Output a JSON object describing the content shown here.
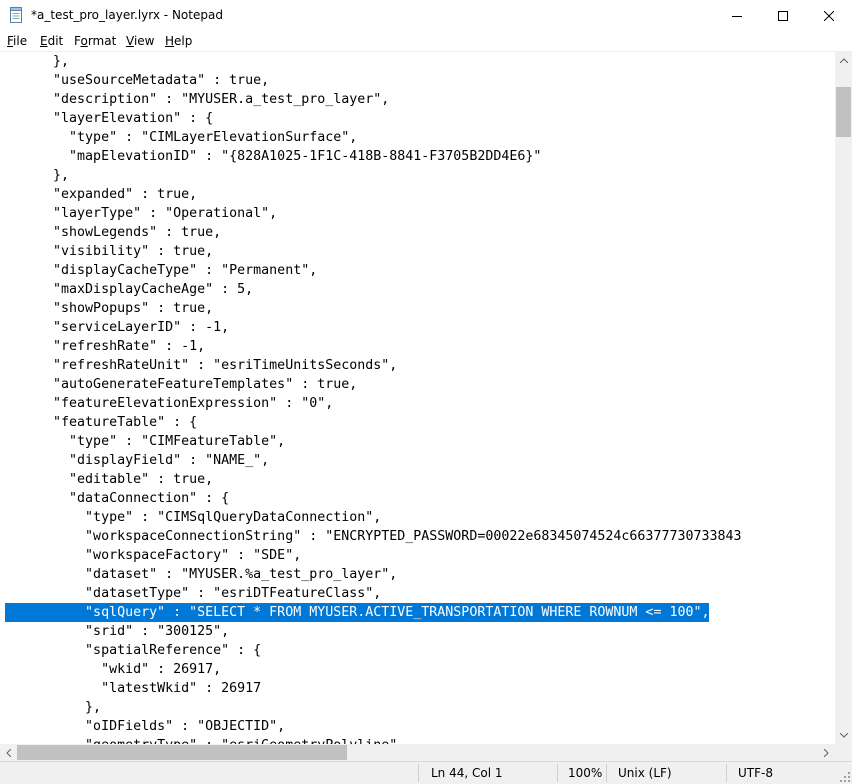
{
  "window": {
    "title": "*a_test_pro_layer.lyrx - Notepad"
  },
  "menu": {
    "items": [
      {
        "underline": "F",
        "rest": "ile"
      },
      {
        "underline": "E",
        "rest": "dit"
      },
      {
        "underline": "",
        "pre": "F",
        "u2": "o",
        "post": "rmat"
      },
      {
        "underline": "V",
        "rest": "iew"
      },
      {
        "underline": "H",
        "rest": "elp"
      }
    ]
  },
  "editor": {
    "lines": [
      "      },",
      "      \"useSourceMetadata\" : true,",
      "      \"description\" : \"MYUSER.a_test_pro_layer\",",
      "      \"layerElevation\" : {",
      "        \"type\" : \"CIMLayerElevationSurface\",",
      "        \"mapElevationID\" : \"{828A1025-1F1C-418B-8841-F3705B2DD4E6}\"",
      "      },",
      "      \"expanded\" : true,",
      "      \"layerType\" : \"Operational\",",
      "      \"showLegends\" : true,",
      "      \"visibility\" : true,",
      "      \"displayCacheType\" : \"Permanent\",",
      "      \"maxDisplayCacheAge\" : 5,",
      "      \"showPopups\" : true,",
      "      \"serviceLayerID\" : -1,",
      "      \"refreshRate\" : -1,",
      "      \"refreshRateUnit\" : \"esriTimeUnitsSeconds\",",
      "      \"autoGenerateFeatureTemplates\" : true,",
      "      \"featureElevationExpression\" : \"0\",",
      "      \"featureTable\" : {",
      "        \"type\" : \"CIMFeatureTable\",",
      "        \"displayField\" : \"NAME_\",",
      "        \"editable\" : true,",
      "        \"dataConnection\" : {",
      "          \"type\" : \"CIMSqlQueryDataConnection\",",
      "          \"workspaceConnectionString\" : \"ENCRYPTED_PASSWORD=00022e68345074524c66377730733843",
      "          \"workspaceFactory\" : \"SDE\",",
      "          \"dataset\" : \"MYUSER.%a_test_pro_layer\",",
      "          \"datasetType\" : \"esriDTFeatureClass\",",
      "          \"sqlQuery\" : \"SELECT * FROM MYUSER.ACTIVE_TRANSPORTATION WHERE ROWNUM <= 100\",",
      "          \"srid\" : \"300125\",",
      "          \"spatialReference\" : {",
      "            \"wkid\" : 26917,",
      "            \"latestWkid\" : 26917",
      "          },",
      "          \"oIDFields\" : \"OBJECTID\",",
      "          \"geometryType\" : \"esriGeometryPolyline\","
    ],
    "selected_line_index": 29
  },
  "status": {
    "position": "Ln 44, Col 1",
    "zoom": "100%",
    "line_ending": "Unix (LF)",
    "encoding": "UTF-8"
  }
}
